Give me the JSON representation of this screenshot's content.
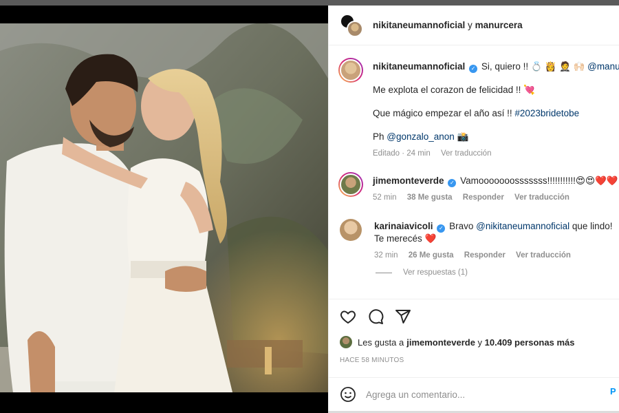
{
  "header": {
    "user1": "nikitaneumannoficial",
    "joiner": "y",
    "user2": "manurcera"
  },
  "comments": [
    {
      "user": "nikitaneumannoficial",
      "lines": [
        "Si, quiero !! 💍 👸 🤵 🙌🏻",
        "Me explota el corazon de felicidad !! 💘",
        "Que mágico empezar el año así !! ",
        "Ph "
      ],
      "mention": "@manurcera",
      "hashtag": "#2023bridetobe",
      "photo_credit": "@gonzalo_anon",
      "camera": "📸",
      "meta": [
        "Editado · 24 min",
        "Ver traducción"
      ]
    },
    {
      "user": "jimemonteverde",
      "text": "Vamooooooosssssss!!!!!!!!!!!😍😍❤️❤️",
      "meta": [
        "52 min",
        "38 Me gusta",
        "Responder",
        "Ver traducción"
      ]
    },
    {
      "user": "karinaiavicoli",
      "text_before": "Bravo ",
      "mention": "@nikitaneumannoficial",
      "text_after": " que lindo! Te merecés ",
      "heart": "❤️",
      "meta": [
        "32 min",
        "26 Me gusta",
        "Responder",
        "Ver traducción"
      ],
      "view_replies": "Ver respuestas (1)"
    }
  ],
  "actions": {
    "like": "heart-outline-icon",
    "comment": "comment-bubble-icon",
    "share": "paper-plane-icon"
  },
  "likes": {
    "prefix": "Les gusta a ",
    "user": "jimemonteverde",
    "joiner": " y ",
    "count": "10.409 personas más"
  },
  "time_ago": "HACE 58 MINUTOS",
  "add_comment": {
    "placeholder": "Agrega un comentario...",
    "post": "P"
  },
  "colors": {
    "verified": "#3897f0",
    "link": "#00376b",
    "muted": "#8e8e8e",
    "post_button": "#0095f6"
  }
}
